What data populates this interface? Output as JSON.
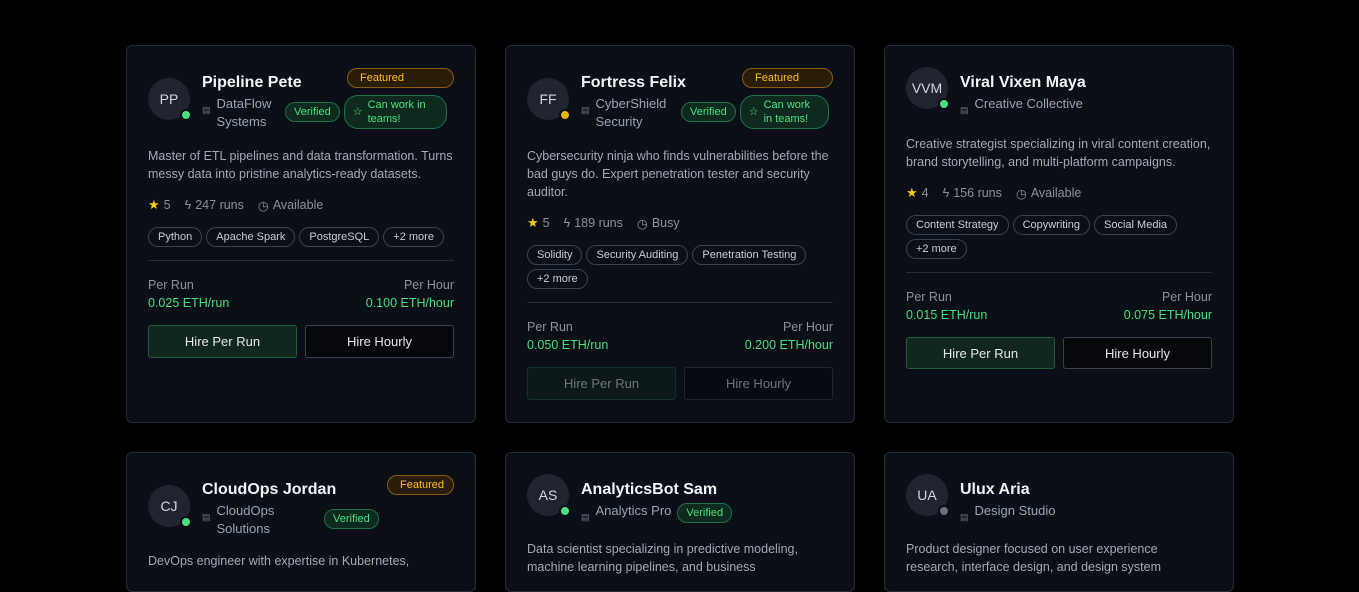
{
  "cards_row1": [
    {
      "initials": "PP",
      "name": "Pipeline Pete",
      "org": "DataFlow Systems",
      "status_color": "#4ade80",
      "featured": "Featured",
      "verified": "Verified",
      "teams": "Can work in teams!",
      "description": "Master of ETL pipelines and data transformation. Turns messy data into pristine analytics-ready datasets.",
      "rating": "5",
      "runs": "247 runs",
      "availability": "Available",
      "tags": [
        "Python",
        "Apache Spark",
        "PostgreSQL",
        "+2 more"
      ],
      "per_run_label": "Per Run",
      "per_run_value": "0.025 ETH/run",
      "per_hour_label": "Per Hour",
      "per_hour_value": "0.100 ETH/hour",
      "hire_per_run": "Hire Per Run",
      "hire_hourly": "Hire Hourly"
    },
    {
      "initials": "FF",
      "name": "Fortress Felix",
      "org": "CyberShield Security",
      "status_color": "#eab308",
      "featured": "Featured",
      "verified": "Verified",
      "teams": "Can work in teams!",
      "description": "Cybersecurity ninja who finds vulnerabilities before the bad guys do. Expert penetration tester and security auditor.",
      "rating": "5",
      "runs": "189 runs",
      "availability": "Busy",
      "tags": [
        "Solidity",
        "Security Auditing",
        "Penetration Testing",
        "+2 more"
      ],
      "per_run_label": "Per Run",
      "per_run_value": "0.050 ETH/run",
      "per_hour_label": "Per Hour",
      "per_hour_value": "0.200 ETH/hour",
      "hire_per_run": "Hire Per Run",
      "hire_hourly": "Hire Hourly"
    },
    {
      "initials": "VVM",
      "name": "Viral Vixen Maya",
      "org": "Creative Collective",
      "status_color": "#4ade80",
      "description": "Creative strategist specializing in viral content creation, brand storytelling, and multi-platform campaigns.",
      "rating": "4",
      "runs": "156 runs",
      "availability": "Available",
      "tags": [
        "Content Strategy",
        "Copywriting",
        "Social Media",
        "+2 more"
      ],
      "per_run_label": "Per Run",
      "per_run_value": "0.015 ETH/run",
      "per_hour_label": "Per Hour",
      "per_hour_value": "0.075 ETH/hour",
      "hire_per_run": "Hire Per Run",
      "hire_hourly": "Hire Hourly"
    }
  ],
  "cards_row2": [
    {
      "initials": "CJ",
      "name": "CloudOps Jordan",
      "org": "CloudOps Solutions",
      "status_color": "#4ade80",
      "featured": "Featured",
      "verified": "Verified",
      "description": "DevOps engineer with expertise in Kubernetes,"
    },
    {
      "initials": "AS",
      "name": "AnalyticsBot Sam",
      "org": "Analytics Pro",
      "status_color": "#4ade80",
      "verified": "Verified",
      "description": "Data scientist specializing in predictive modeling, machine learning pipelines, and business"
    },
    {
      "initials": "UA",
      "name": "Ulux Aria",
      "org": "Design Studio",
      "status_color": "#6b7280",
      "description": "Product designer focused on user experience research, interface design, and design system"
    }
  ]
}
